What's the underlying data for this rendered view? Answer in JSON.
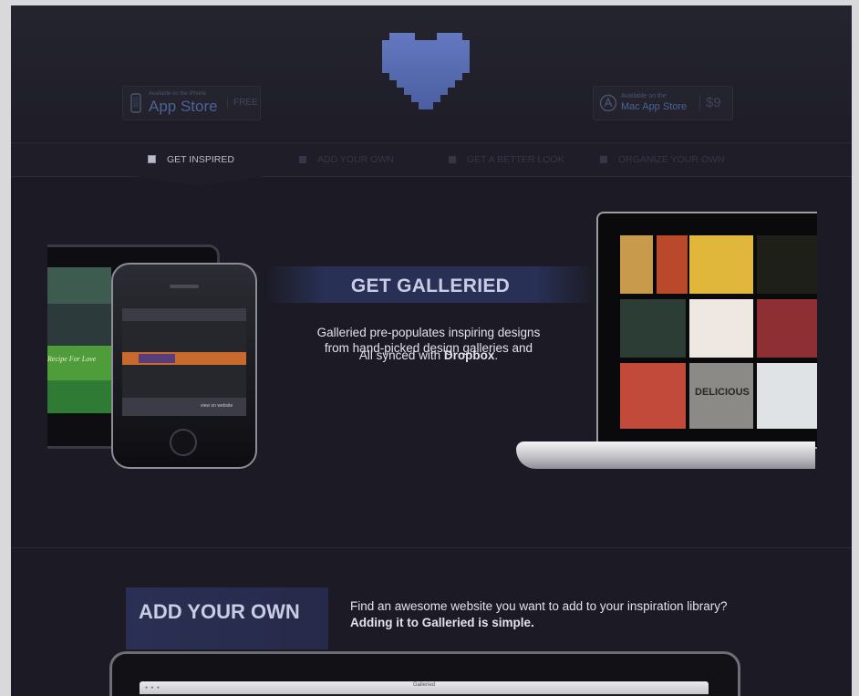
{
  "header": {
    "ios_badge": {
      "small": "Available on the iPhone",
      "title": "App Store",
      "price": "FREE"
    },
    "mac_badge": {
      "small": "Available on the",
      "title": "Mac App Store",
      "price": "$9"
    }
  },
  "nav": {
    "items": [
      {
        "label": "GET INSPIRED",
        "active": true
      },
      {
        "label": "ADD YOUR OWN",
        "active": false
      },
      {
        "label": "GET A BETTER LOOK",
        "active": false
      },
      {
        "label": "ORGANIZE YOUR OWN",
        "active": false
      }
    ]
  },
  "hero": {
    "title": "GET GALLERIED",
    "text_line1": "Galleried pre-populates inspiring designs",
    "text_line2": "from hand-picked design galleries and",
    "synced_prefix": "All synced with ",
    "synced_strong": "Dropbox",
    "synced_suffix": "."
  },
  "devices": {
    "ipad_screen_text": "Recipe For Love",
    "iphone_screen_link": "view on website",
    "laptop_tile_text": "DELICIOUS"
  },
  "add_section": {
    "title": "ADD YOUR OWN",
    "text_plain": "Find an awesome website you want to add to your inspiration library? ",
    "text_strong": "Adding it to Galleried is simple."
  },
  "browser": {
    "window_title": "Galleried"
  },
  "colors": {
    "page_bg": "#1c1b25",
    "accent_band": "#283055",
    "logo_blue": "#5a6fb0",
    "text_light": "#e2e3ea"
  }
}
